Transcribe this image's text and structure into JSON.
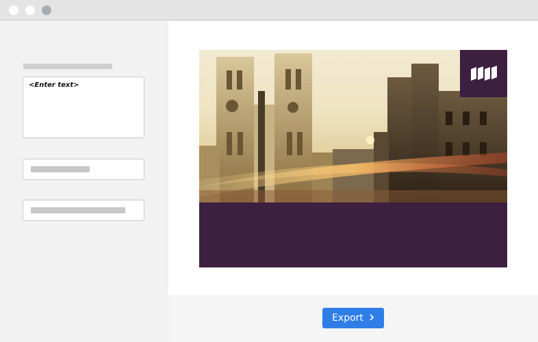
{
  "editor": {
    "text_placeholder": "<Enter text>"
  },
  "toolbar": {
    "export_label": "Export",
    "export_icon": "chevron-right-icon"
  },
  "card": {
    "logo_icon": "brand-logo-icon",
    "banner_color": "#3d1f40"
  },
  "colors": {
    "accent": "#2f7ee8",
    "banner": "#3d1f40"
  }
}
